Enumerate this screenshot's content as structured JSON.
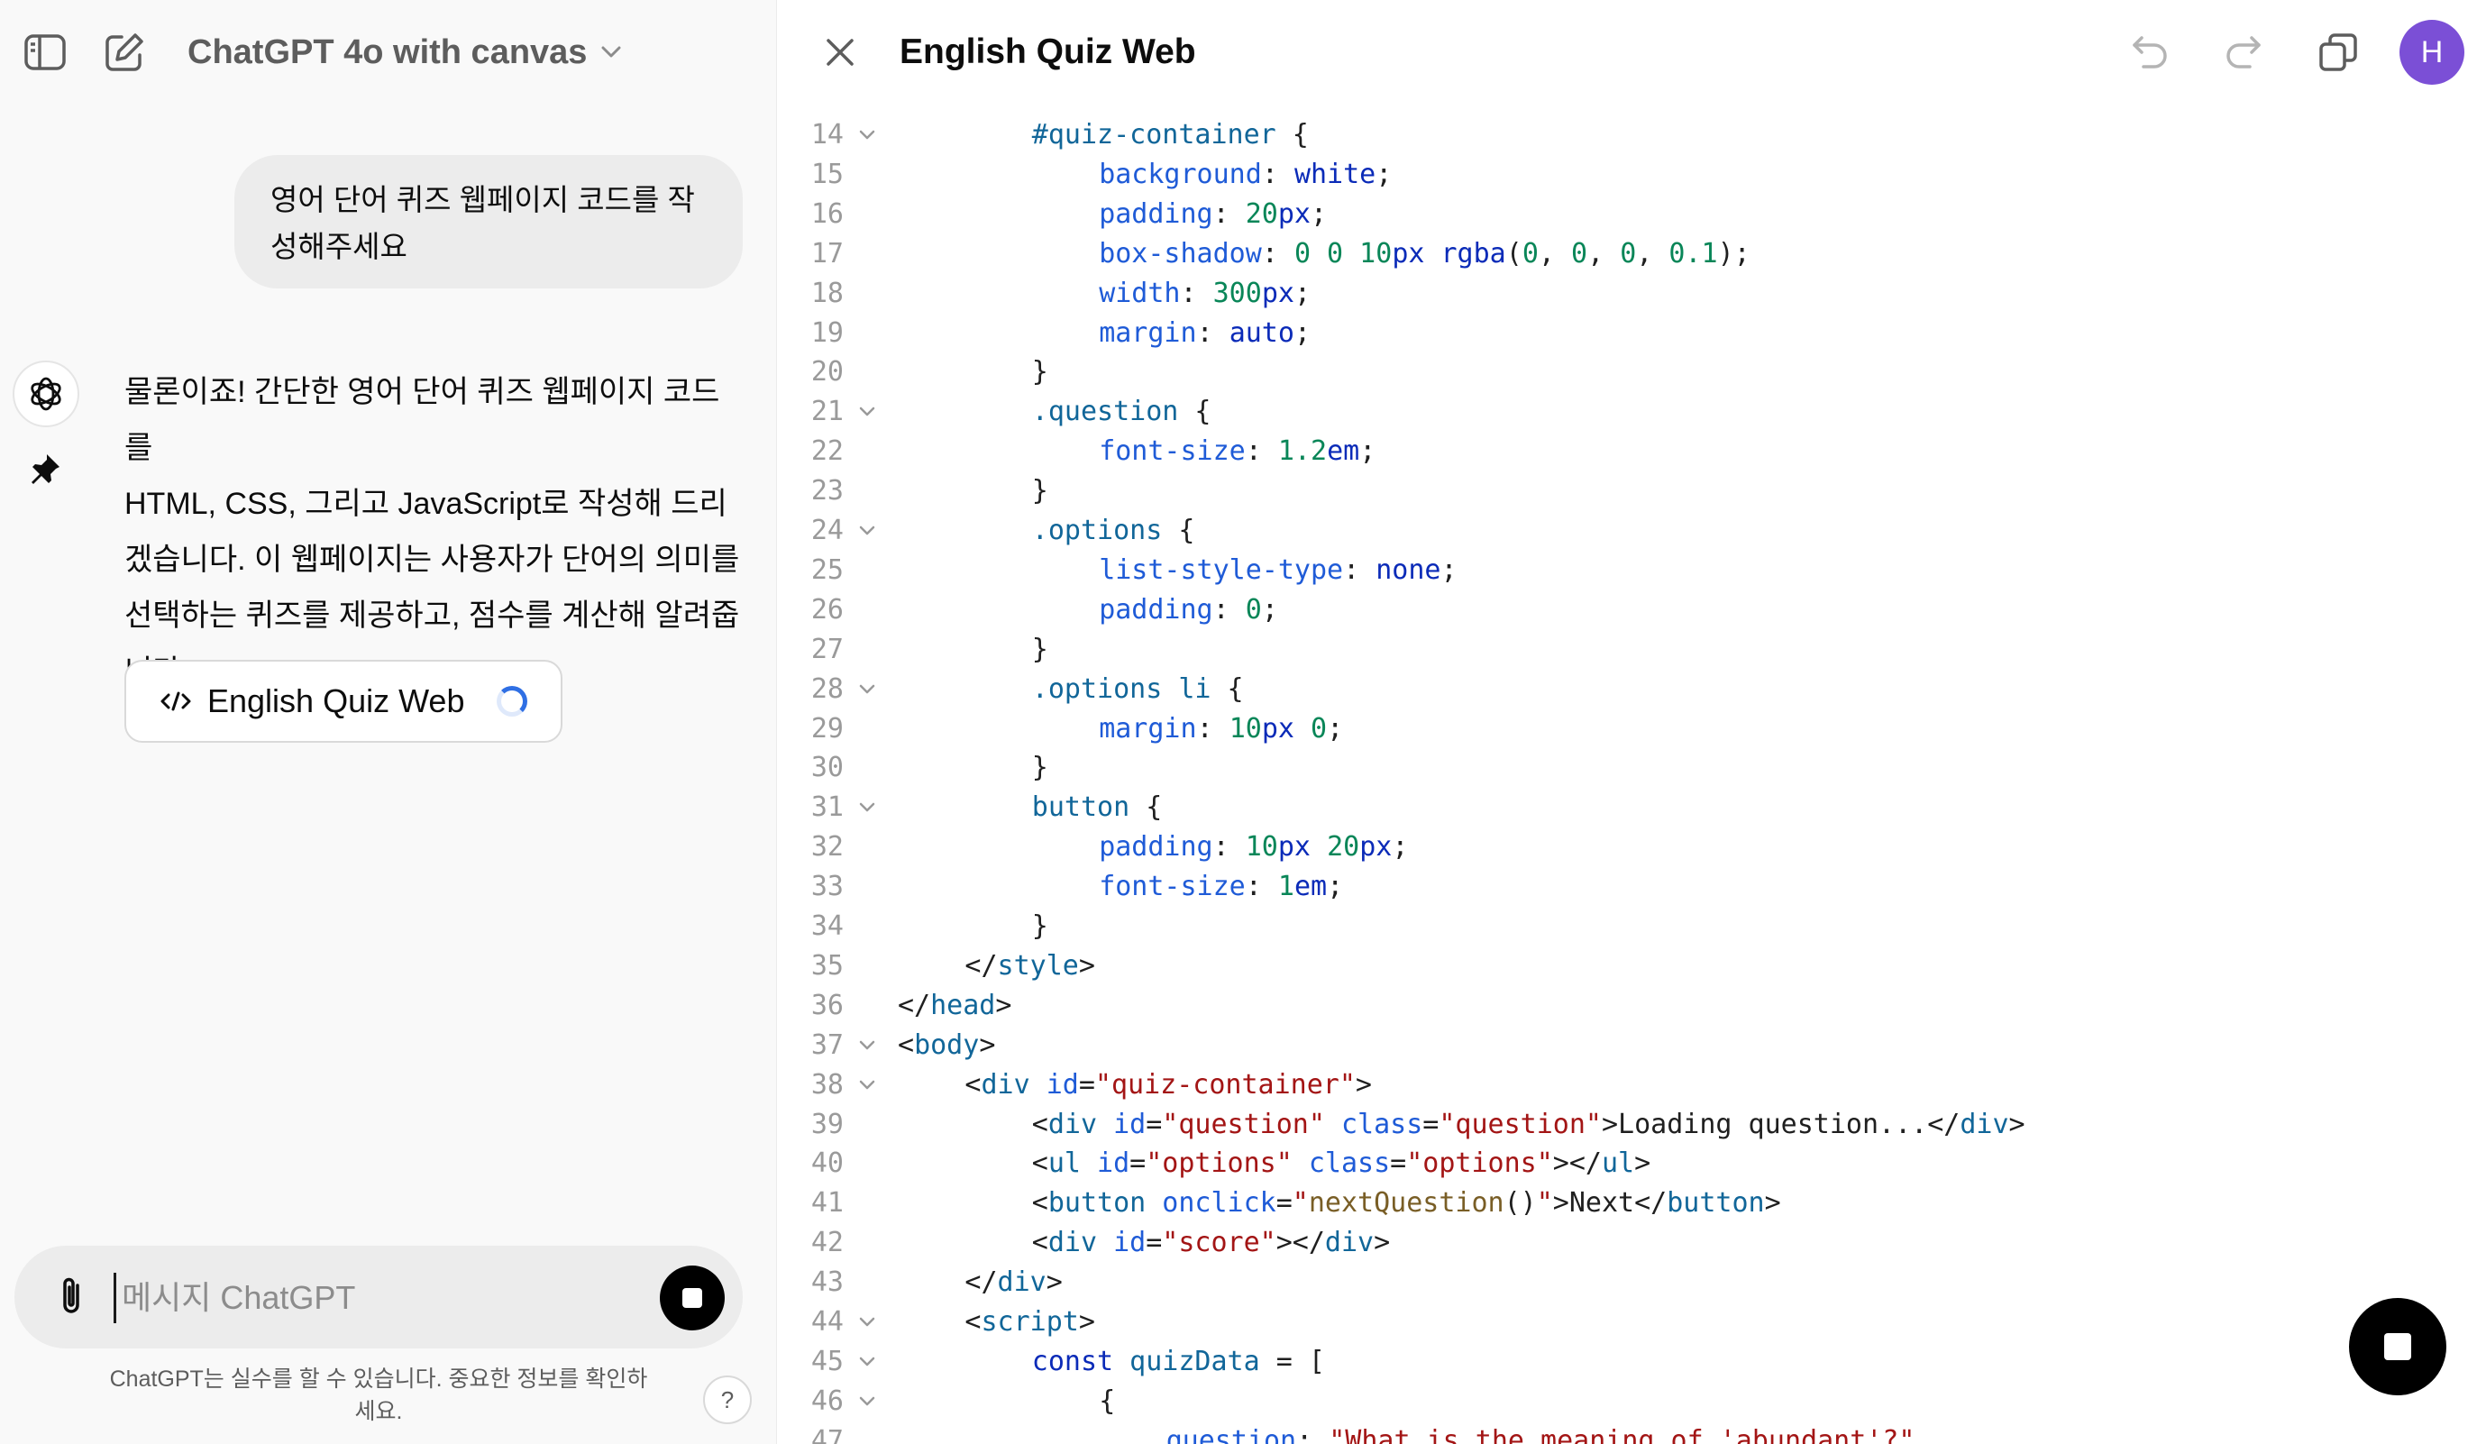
{
  "left": {
    "model_selector": "ChatGPT 4o with canvas",
    "user_message_lines": [
      "영어 단어 퀴즈 웹페이지 코드를 작",
      "성해주세요"
    ],
    "assistant_lines": [
      "물론이죠! 간단한 영어 단어 퀴즈 웹페이지 코드를",
      "HTML, CSS, 그리고 JavaScript로 작성해 드리",
      "겠습니다. 이 웹페이지는 사용자가 단어의 의미를",
      "선택하는 퀴즈를 제공하고, 점수를 계산해 알려줍",
      "니다."
    ],
    "artifact_title": "English Quiz Web",
    "composer_placeholder": "메시지 ChatGPT",
    "disclaimer_lines": [
      "ChatGPT는 실수를 할 수 있습니다. 중요한 정보를 확인하",
      "세요."
    ],
    "help_label": "?"
  },
  "canvas": {
    "title": "English Quiz Web",
    "avatar_initial": "H",
    "colors": {
      "avatar": "#7b4fd6",
      "accent_blue": "#2f6fe4",
      "stop": "#000000"
    },
    "code_lines": [
      {
        "n": "14",
        "fold": true,
        "indent": 8,
        "tokens": [
          [
            "sel",
            "#quiz-container"
          ],
          [
            "pl",
            " {"
          ]
        ]
      },
      {
        "n": "15",
        "fold": false,
        "indent": 12,
        "tokens": [
          [
            "prop",
            "background"
          ],
          [
            "pl",
            ": "
          ],
          [
            "val",
            "white"
          ],
          [
            "pl",
            ";"
          ]
        ]
      },
      {
        "n": "16",
        "fold": false,
        "indent": 12,
        "tokens": [
          [
            "prop",
            "padding"
          ],
          [
            "pl",
            ": "
          ],
          [
            "num",
            "20"
          ],
          [
            "val",
            "px"
          ],
          [
            "pl",
            ";"
          ]
        ]
      },
      {
        "n": "17",
        "fold": false,
        "indent": 12,
        "tokens": [
          [
            "prop",
            "box-shadow"
          ],
          [
            "pl",
            ": "
          ],
          [
            "num",
            "0 0 10"
          ],
          [
            "val",
            "px "
          ],
          [
            "val",
            "rgba"
          ],
          [
            "pl",
            "("
          ],
          [
            "num",
            "0"
          ],
          [
            "pl",
            ", "
          ],
          [
            "num",
            "0"
          ],
          [
            "pl",
            ", "
          ],
          [
            "num",
            "0"
          ],
          [
            "pl",
            ", "
          ],
          [
            "num",
            "0.1"
          ],
          [
            "pl",
            ");"
          ]
        ]
      },
      {
        "n": "18",
        "fold": false,
        "indent": 12,
        "tokens": [
          [
            "prop",
            "width"
          ],
          [
            "pl",
            ": "
          ],
          [
            "num",
            "300"
          ],
          [
            "val",
            "px"
          ],
          [
            "pl",
            ";"
          ]
        ]
      },
      {
        "n": "19",
        "fold": false,
        "indent": 12,
        "tokens": [
          [
            "prop",
            "margin"
          ],
          [
            "pl",
            ": "
          ],
          [
            "val",
            "auto"
          ],
          [
            "pl",
            ";"
          ]
        ]
      },
      {
        "n": "20",
        "fold": false,
        "indent": 8,
        "tokens": [
          [
            "pl",
            "}"
          ]
        ]
      },
      {
        "n": "21",
        "fold": true,
        "indent": 8,
        "tokens": [
          [
            "sel",
            ".question"
          ],
          [
            "pl",
            " {"
          ]
        ]
      },
      {
        "n": "22",
        "fold": false,
        "indent": 12,
        "tokens": [
          [
            "prop",
            "font-size"
          ],
          [
            "pl",
            ": "
          ],
          [
            "num",
            "1.2"
          ],
          [
            "val",
            "em"
          ],
          [
            "pl",
            ";"
          ]
        ]
      },
      {
        "n": "23",
        "fold": false,
        "indent": 8,
        "tokens": [
          [
            "pl",
            "}"
          ]
        ]
      },
      {
        "n": "24",
        "fold": true,
        "indent": 8,
        "tokens": [
          [
            "sel",
            ".options"
          ],
          [
            "pl",
            " {"
          ]
        ]
      },
      {
        "n": "25",
        "fold": false,
        "indent": 12,
        "tokens": [
          [
            "prop",
            "list-style-type"
          ],
          [
            "pl",
            ": "
          ],
          [
            "val",
            "none"
          ],
          [
            "pl",
            ";"
          ]
        ]
      },
      {
        "n": "26",
        "fold": false,
        "indent": 12,
        "tokens": [
          [
            "prop",
            "padding"
          ],
          [
            "pl",
            ": "
          ],
          [
            "num",
            "0"
          ],
          [
            "pl",
            ";"
          ]
        ]
      },
      {
        "n": "27",
        "fold": false,
        "indent": 8,
        "tokens": [
          [
            "pl",
            "}"
          ]
        ]
      },
      {
        "n": "28",
        "fold": true,
        "indent": 8,
        "tokens": [
          [
            "sel",
            ".options li"
          ],
          [
            "pl",
            " {"
          ]
        ]
      },
      {
        "n": "29",
        "fold": false,
        "indent": 12,
        "tokens": [
          [
            "prop",
            "margin"
          ],
          [
            "pl",
            ": "
          ],
          [
            "num",
            "10"
          ],
          [
            "val",
            "px "
          ],
          [
            "num",
            "0"
          ],
          [
            "pl",
            ";"
          ]
        ]
      },
      {
        "n": "30",
        "fold": false,
        "indent": 8,
        "tokens": [
          [
            "pl",
            "}"
          ]
        ]
      },
      {
        "n": "31",
        "fold": true,
        "indent": 8,
        "tokens": [
          [
            "sel",
            "button"
          ],
          [
            "pl",
            " {"
          ]
        ]
      },
      {
        "n": "32",
        "fold": false,
        "indent": 12,
        "tokens": [
          [
            "prop",
            "padding"
          ],
          [
            "pl",
            ": "
          ],
          [
            "num",
            "10"
          ],
          [
            "val",
            "px "
          ],
          [
            "num",
            "20"
          ],
          [
            "val",
            "px"
          ],
          [
            "pl",
            ";"
          ]
        ]
      },
      {
        "n": "33",
        "fold": false,
        "indent": 12,
        "tokens": [
          [
            "prop",
            "font-size"
          ],
          [
            "pl",
            ": "
          ],
          [
            "num",
            "1"
          ],
          [
            "val",
            "em"
          ],
          [
            "pl",
            ";"
          ]
        ]
      },
      {
        "n": "34",
        "fold": false,
        "indent": 8,
        "tokens": [
          [
            "pl",
            "}"
          ]
        ]
      },
      {
        "n": "35",
        "fold": false,
        "indent": 4,
        "tokens": [
          [
            "pl",
            "</"
          ],
          [
            "tag",
            "style"
          ],
          [
            "pl",
            ">"
          ]
        ]
      },
      {
        "n": "36",
        "fold": false,
        "indent": 0,
        "tokens": [
          [
            "pl",
            "</"
          ],
          [
            "tag",
            "head"
          ],
          [
            "pl",
            ">"
          ]
        ]
      },
      {
        "n": "37",
        "fold": true,
        "indent": 0,
        "tokens": [
          [
            "pl",
            "<"
          ],
          [
            "tag",
            "body"
          ],
          [
            "pl",
            ">"
          ]
        ]
      },
      {
        "n": "38",
        "fold": true,
        "indent": 4,
        "tokens": [
          [
            "pl",
            "<"
          ],
          [
            "tag",
            "div"
          ],
          [
            "pl",
            " "
          ],
          [
            "attr",
            "id"
          ],
          [
            "pl",
            "="
          ],
          [
            "str",
            "\"quiz-container\""
          ],
          [
            "pl",
            ">"
          ]
        ]
      },
      {
        "n": "39",
        "fold": false,
        "indent": 8,
        "tokens": [
          [
            "pl",
            "<"
          ],
          [
            "tag",
            "div"
          ],
          [
            "pl",
            " "
          ],
          [
            "attr",
            "id"
          ],
          [
            "pl",
            "="
          ],
          [
            "str",
            "\"question\""
          ],
          [
            "pl",
            " "
          ],
          [
            "attr",
            "class"
          ],
          [
            "pl",
            "="
          ],
          [
            "str",
            "\"question\""
          ],
          [
            "pl",
            ">Loading question...</"
          ],
          [
            "tag",
            "div"
          ],
          [
            "pl",
            ">"
          ]
        ]
      },
      {
        "n": "40",
        "fold": false,
        "indent": 8,
        "tokens": [
          [
            "pl",
            "<"
          ],
          [
            "tag",
            "ul"
          ],
          [
            "pl",
            " "
          ],
          [
            "attr",
            "id"
          ],
          [
            "pl",
            "="
          ],
          [
            "str",
            "\"options\""
          ],
          [
            "pl",
            " "
          ],
          [
            "attr",
            "class"
          ],
          [
            "pl",
            "="
          ],
          [
            "str",
            "\"options\""
          ],
          [
            "pl",
            "></"
          ],
          [
            "tag",
            "ul"
          ],
          [
            "pl",
            ">"
          ]
        ]
      },
      {
        "n": "41",
        "fold": false,
        "indent": 8,
        "tokens": [
          [
            "pl",
            "<"
          ],
          [
            "tag",
            "button"
          ],
          [
            "pl",
            " "
          ],
          [
            "attr",
            "onclick"
          ],
          [
            "pl",
            "="
          ],
          [
            "str",
            "\""
          ],
          [
            "fn",
            "nextQuestion"
          ],
          [
            "pl",
            "()"
          ],
          [
            "str",
            "\""
          ],
          [
            "pl",
            ">Next</"
          ],
          [
            "tag",
            "button"
          ],
          [
            "pl",
            ">"
          ]
        ]
      },
      {
        "n": "42",
        "fold": false,
        "indent": 8,
        "tokens": [
          [
            "pl",
            "<"
          ],
          [
            "tag",
            "div"
          ],
          [
            "pl",
            " "
          ],
          [
            "attr",
            "id"
          ],
          [
            "pl",
            "="
          ],
          [
            "str",
            "\"score\""
          ],
          [
            "pl",
            "></"
          ],
          [
            "tag",
            "div"
          ],
          [
            "pl",
            ">"
          ]
        ]
      },
      {
        "n": "43",
        "fold": false,
        "indent": 4,
        "tokens": [
          [
            "pl",
            "</"
          ],
          [
            "tag",
            "div"
          ],
          [
            "pl",
            ">"
          ]
        ]
      },
      {
        "n": "44",
        "fold": true,
        "indent": 4,
        "tokens": [
          [
            "pl",
            "<"
          ],
          [
            "tag",
            "script"
          ],
          [
            "pl",
            ">"
          ]
        ]
      },
      {
        "n": "45",
        "fold": true,
        "indent": 8,
        "tokens": [
          [
            "kw",
            "const"
          ],
          [
            "pl",
            " "
          ],
          [
            "tag",
            "quizData"
          ],
          [
            "pl",
            " = ["
          ]
        ]
      },
      {
        "n": "46",
        "fold": true,
        "indent": 12,
        "tokens": [
          [
            "pl",
            "{"
          ]
        ]
      },
      {
        "n": "47",
        "fold": false,
        "indent": 16,
        "tokens": [
          [
            "attr",
            "question"
          ],
          [
            "pl",
            ": "
          ],
          [
            "str",
            "\"What is the meaning of 'abundant'?\""
          ],
          [
            "pl",
            ","
          ]
        ]
      }
    ]
  }
}
